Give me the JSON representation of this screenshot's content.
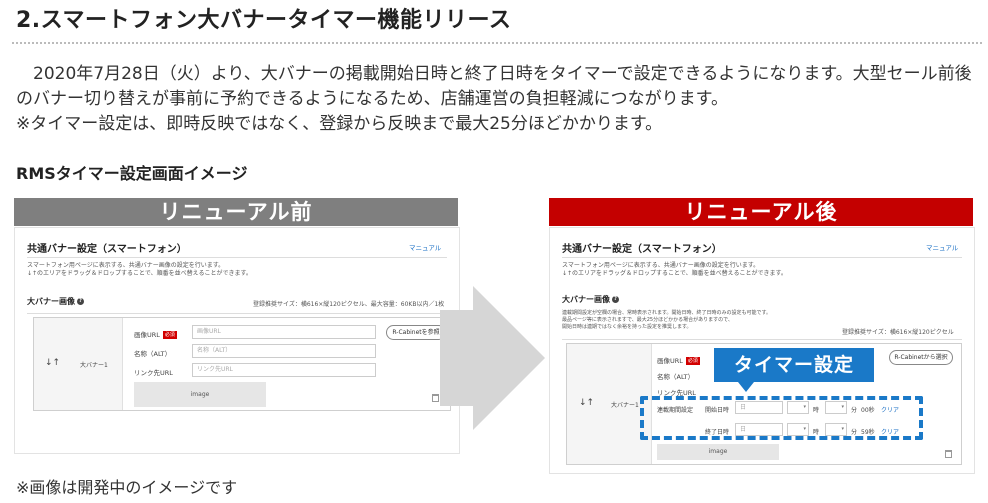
{
  "article": {
    "title": "2.スマートフォン大バナータイマー機能リリース",
    "intro_line1": "2020年7月28日（火）より、大バナーの掲載開始日時と終了日時をタイマーで設定できるようになります。大型セール前後のバナー切り替えが事前に予約できるようになるため、店舗運営の負担軽減につながります。",
    "intro_line2": "※タイマー設定は、即時反映ではなく、登録から反映まで最大25分ほどかかります。",
    "subheading": "RMSタイマー設定画面イメージ",
    "footnote": "※画像は開発中のイメージです"
  },
  "before": {
    "banner": "リニューアル前",
    "panel_title": "共通バナー設定（スマートフォン）",
    "manual_link": "マニュアル",
    "desc1": "スマートフォン用ページに表示する、共通バナー画像の設定を行います。",
    "desc2": "↓↑のエリアをドラッグ＆ドロップすることで、順番を並べ替えることができます。",
    "section_title": "大バナー画像",
    "size_note": "登録推奨サイズ：横616×縦120ピクセル、最大容量：60KB以内／1枚",
    "row_label": "大バナー1",
    "drag_icon": "↓↑",
    "field_image_url": "画像URL",
    "required_badge": "必須",
    "placeholder_image_url": "画像URL",
    "rcabinet_button": "R-Cabinetを参照",
    "field_alt": "名称（ALT）",
    "placeholder_alt": "名称（ALT）",
    "field_link": "リンク先URL",
    "placeholder_link": "リンク先URL",
    "image_placeholder": "image"
  },
  "after": {
    "banner": "リニューアル後",
    "panel_title": "共通バナー設定（スマートフォン）",
    "manual_link": "マニュアル",
    "desc1": "スマートフォン用ページに表示する、共通バナー画像の設定を行います。",
    "desc2": "↓↑のエリアをドラッグ＆ドロップすることで、順番を並べ替えることができます。",
    "section_title": "大バナー画像",
    "note1": "連載期間設定が空欄の場合、常時表示されます。開始日時、終了日時のみの設定も可能です。",
    "note2": "最品ページ等に表示されますで、最大25分ほどかかる場合がありますので、",
    "note3": "開始日時は連期ではなく余裕を持った設定を推奨します。",
    "size_note": "登録推奨サイズ：横616×縦120ピクセル",
    "row_label": "大バナー1",
    "drag_icon": "↓↑",
    "field_image_url": "画像URL",
    "required_badge": "必須",
    "rcabinet_button": "R-Cabinetから選択",
    "field_alt": "名称（ALT）",
    "field_link": "リンク先URL",
    "period_label": "連載期間設定",
    "start_label": "開始日時",
    "end_label": "終了日時",
    "date_placeholder": "日",
    "hour_unit": "時",
    "minute_unit": "分",
    "start_seconds": "00秒",
    "end_seconds": "59秒",
    "clear_link": "クリア",
    "image_placeholder": "image"
  },
  "callout": {
    "label": "タイマー設定",
    "color": "#1a79c8"
  },
  "colors": {
    "before_banner": "#7f7f7f",
    "after_banner": "#c40000",
    "required": "#d20000",
    "link": "#1a6fc4"
  }
}
